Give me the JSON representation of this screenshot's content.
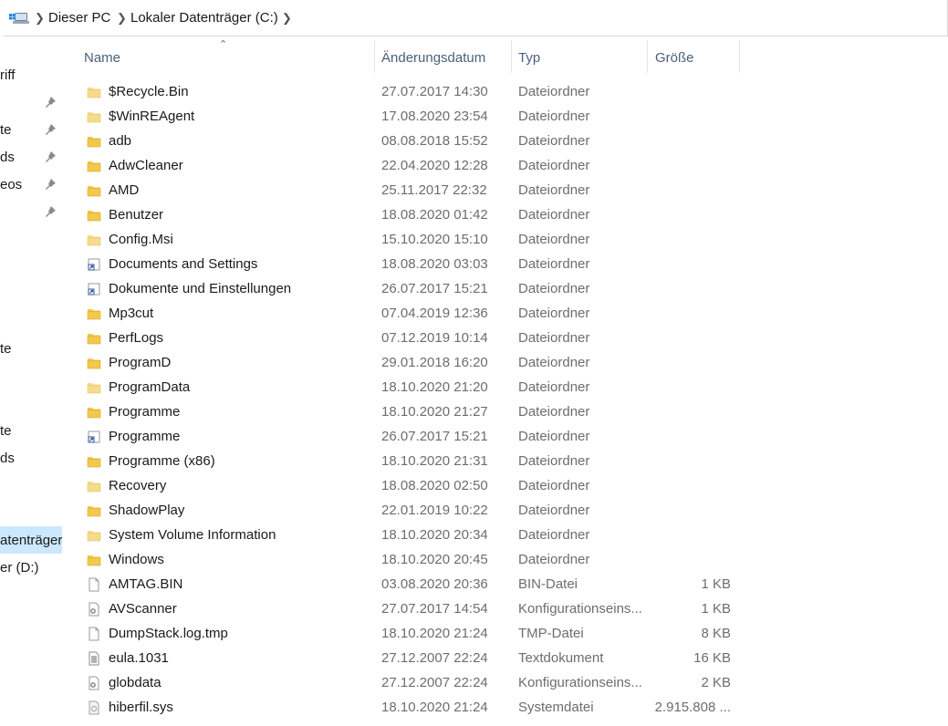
{
  "breadcrumb": [
    "Dieser PC",
    "Lokaler Datenträger (C:)"
  ],
  "nav": {
    "items": [
      "riff",
      "te",
      "ds",
      "eos",
      "te",
      "te",
      "ds",
      "atenträger",
      "er (D:)"
    ],
    "selected_index": 7
  },
  "columns": {
    "name": "Name",
    "date": "Änderungsdatum",
    "type": "Typ",
    "size": "Größe"
  },
  "files": [
    {
      "name": "$Recycle.Bin",
      "date": "27.07.2017 14:30",
      "type": "Dateiordner",
      "size": "",
      "icon": "folder-light-icon"
    },
    {
      "name": "$WinREAgent",
      "date": "17.08.2020 23:54",
      "type": "Dateiordner",
      "size": "",
      "icon": "folder-light-icon"
    },
    {
      "name": "adb",
      "date": "08.08.2018 15:52",
      "type": "Dateiordner",
      "size": "",
      "icon": "folder-icon"
    },
    {
      "name": "AdwCleaner",
      "date": "22.04.2020 12:28",
      "type": "Dateiordner",
      "size": "",
      "icon": "folder-icon"
    },
    {
      "name": "AMD",
      "date": "25.11.2017 22:32",
      "type": "Dateiordner",
      "size": "",
      "icon": "folder-icon"
    },
    {
      "name": "Benutzer",
      "date": "18.08.2020 01:42",
      "type": "Dateiordner",
      "size": "",
      "icon": "folder-icon"
    },
    {
      "name": "Config.Msi",
      "date": "15.10.2020 15:10",
      "type": "Dateiordner",
      "size": "",
      "icon": "folder-light-icon"
    },
    {
      "name": "Documents and Settings",
      "date": "18.08.2020 03:03",
      "type": "Dateiordner",
      "size": "",
      "icon": "shortcut-icon"
    },
    {
      "name": "Dokumente und Einstellungen",
      "date": "26.07.2017 15:21",
      "type": "Dateiordner",
      "size": "",
      "icon": "shortcut-icon"
    },
    {
      "name": "Mp3cut",
      "date": "07.04.2019 12:36",
      "type": "Dateiordner",
      "size": "",
      "icon": "folder-icon"
    },
    {
      "name": "PerfLogs",
      "date": "07.12.2019 10:14",
      "type": "Dateiordner",
      "size": "",
      "icon": "folder-icon"
    },
    {
      "name": "ProgramD",
      "date": "29.01.2018 16:20",
      "type": "Dateiordner",
      "size": "",
      "icon": "folder-icon"
    },
    {
      "name": "ProgramData",
      "date": "18.10.2020 21:20",
      "type": "Dateiordner",
      "size": "",
      "icon": "folder-light-icon"
    },
    {
      "name": "Programme",
      "date": "18.10.2020 21:27",
      "type": "Dateiordner",
      "size": "",
      "icon": "folder-icon"
    },
    {
      "name": "Programme",
      "date": "26.07.2017 15:21",
      "type": "Dateiordner",
      "size": "",
      "icon": "shortcut-icon"
    },
    {
      "name": "Programme (x86)",
      "date": "18.10.2020 21:31",
      "type": "Dateiordner",
      "size": "",
      "icon": "folder-icon"
    },
    {
      "name": "Recovery",
      "date": "18.08.2020 02:50",
      "type": "Dateiordner",
      "size": "",
      "icon": "folder-light-icon"
    },
    {
      "name": "ShadowPlay",
      "date": "22.01.2019 10:22",
      "type": "Dateiordner",
      "size": "",
      "icon": "folder-icon"
    },
    {
      "name": "System Volume Information",
      "date": "18.10.2020 20:34",
      "type": "Dateiordner",
      "size": "",
      "icon": "folder-light-icon"
    },
    {
      "name": "Windows",
      "date": "18.10.2020 20:45",
      "type": "Dateiordner",
      "size": "",
      "icon": "folder-icon"
    },
    {
      "name": "AMTAG.BIN",
      "date": "03.08.2020 20:36",
      "type": "BIN-Datei",
      "size": "1 KB",
      "icon": "file-icon"
    },
    {
      "name": "AVScanner",
      "date": "27.07.2017 14:54",
      "type": "Konfigurationseins...",
      "size": "1 KB",
      "icon": "config-file-icon"
    },
    {
      "name": "DumpStack.log.tmp",
      "date": "18.10.2020 21:24",
      "type": "TMP-Datei",
      "size": "8 KB",
      "icon": "file-icon"
    },
    {
      "name": "eula.1031",
      "date": "27.12.2007 22:24",
      "type": "Textdokument",
      "size": "16 KB",
      "icon": "text-file-icon"
    },
    {
      "name": "globdata",
      "date": "27.12.2007 22:24",
      "type": "Konfigurationseins...",
      "size": "2 KB",
      "icon": "config-file-icon"
    },
    {
      "name": "hiberfil.sys",
      "date": "18.10.2020 21:24",
      "type": "Systemdatei",
      "size": "2.915.808 ...",
      "icon": "system-file-icon"
    }
  ],
  "colors": {
    "folder": "#f2c94c",
    "folder_light": "#f6dc8a",
    "selection": "#cce8ff",
    "header_text": "#4c607a"
  }
}
